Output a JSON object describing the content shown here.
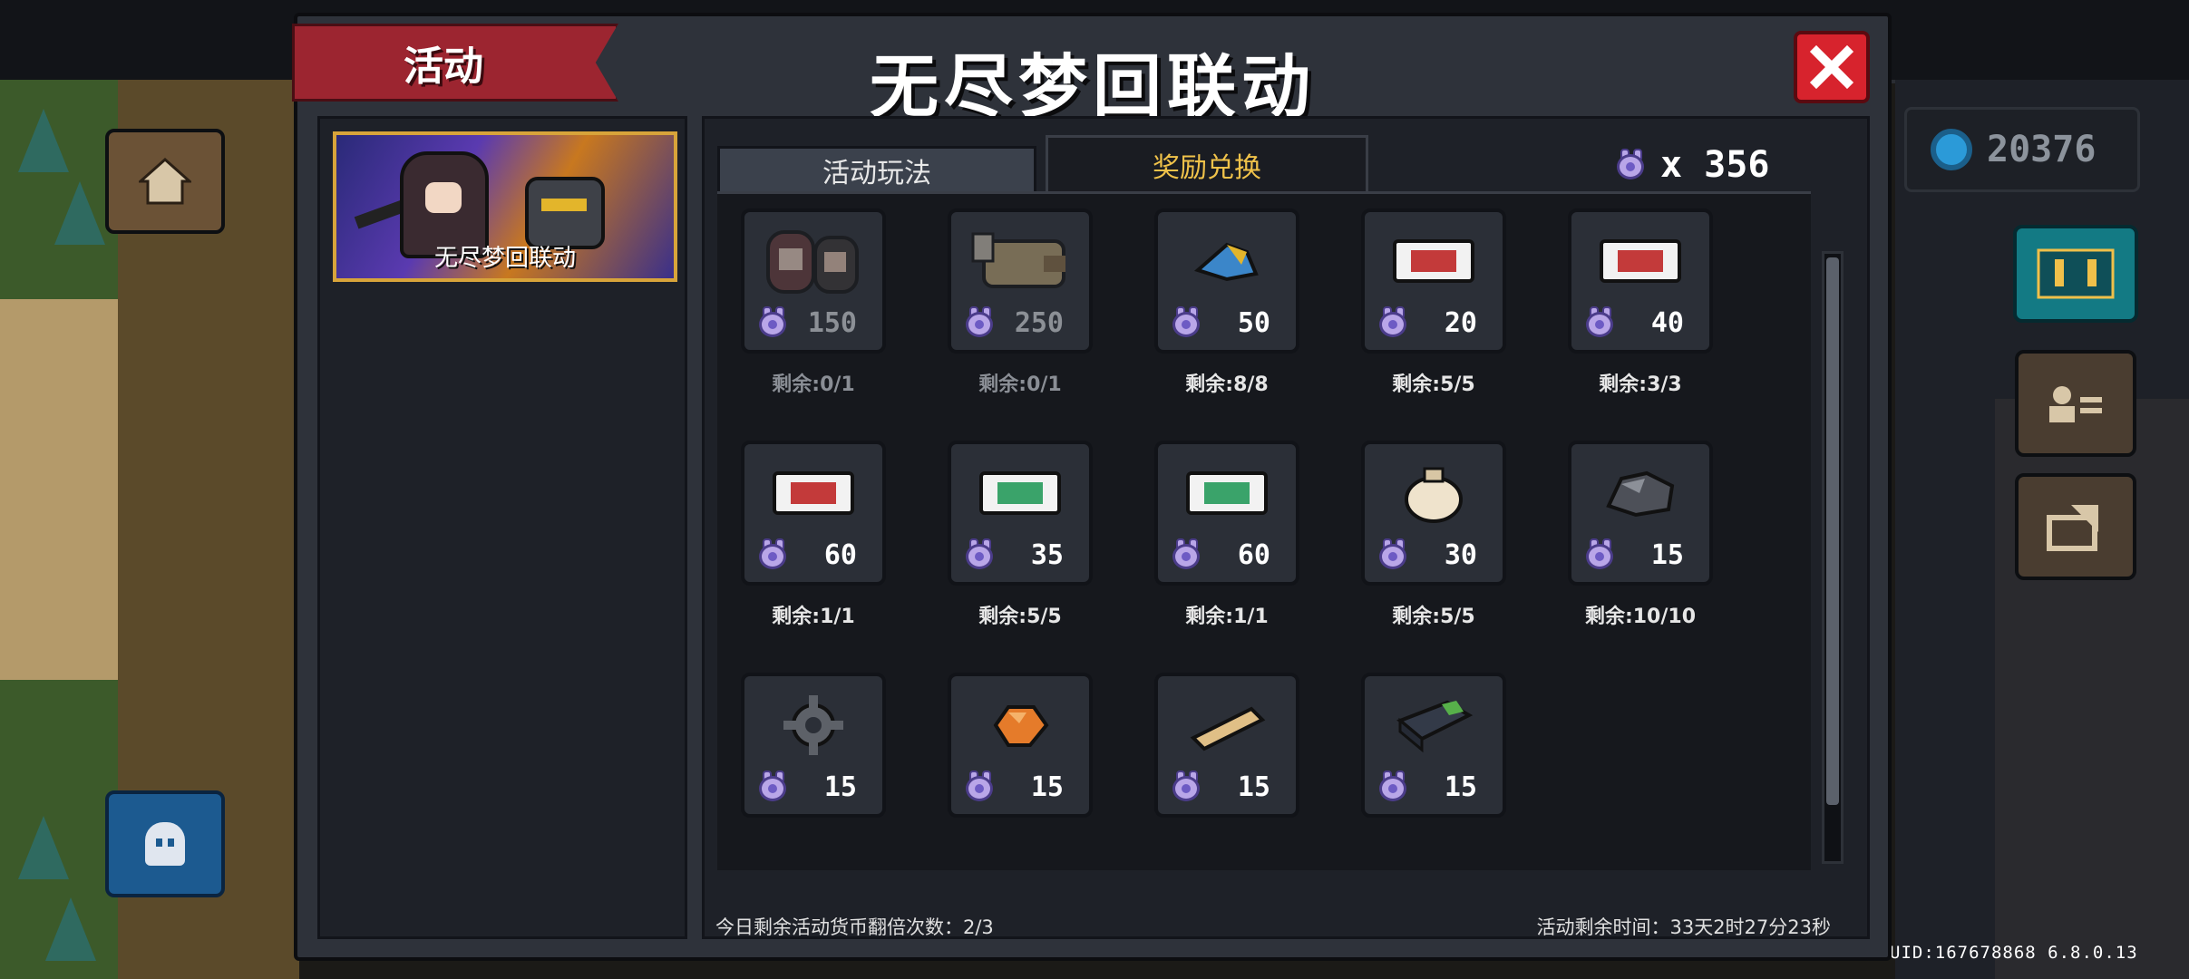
{
  "modal": {
    "category_label": "活动",
    "title": "无尽梦回联动"
  },
  "sidebar": {
    "events": [
      {
        "label": "无尽梦回联动",
        "selected": true
      }
    ]
  },
  "tabs": [
    {
      "label": "活动玩法",
      "active": false
    },
    {
      "label": "奖励兑换",
      "active": true
    }
  ],
  "currency": {
    "icon": "snail-token-icon",
    "label": "x 356"
  },
  "shop": {
    "items": [
      {
        "icon": "character-duo-icon",
        "price": "150",
        "stock": "剩余:0/1",
        "sold_out": true
      },
      {
        "icon": "pig-pet-icon",
        "price": "250",
        "stock": "剩余:0/1",
        "sold_out": true
      },
      {
        "icon": "fish-icon",
        "price": "50",
        "stock": "剩余:8/8",
        "sold_out": false
      },
      {
        "icon": "red-ticket-icon",
        "price": "20",
        "stock": "剩余:5/5",
        "sold_out": false
      },
      {
        "icon": "red-ticket-icon",
        "price": "40",
        "stock": "剩余:3/3",
        "sold_out": false
      },
      {
        "icon": "red-ticket-icon",
        "price": "60",
        "stock": "剩余:1/1",
        "sold_out": false
      },
      {
        "icon": "green-ticket-icon",
        "price": "35",
        "stock": "剩余:5/5",
        "sold_out": false
      },
      {
        "icon": "green-ticket-icon",
        "price": "60",
        "stock": "剩余:1/1",
        "sold_out": false
      },
      {
        "icon": "sack-icon",
        "price": "30",
        "stock": "剩余:5/5",
        "sold_out": false
      },
      {
        "icon": "ore-icon",
        "price": "15",
        "stock": "剩余:10/10",
        "sold_out": false
      },
      {
        "icon": "gear-icon",
        "price": "15",
        "stock": "",
        "sold_out": false
      },
      {
        "icon": "orange-gem-icon",
        "price": "15",
        "stock": "",
        "sold_out": false
      },
      {
        "icon": "wood-plank-icon",
        "price": "15",
        "stock": "",
        "sold_out": false
      },
      {
        "icon": "battery-icon",
        "price": "15",
        "stock": "",
        "sold_out": false
      }
    ]
  },
  "footer": {
    "double_count": "今日剩余活动货币翻倍次数：2/3",
    "time_left": "活动剩余时间：33天2时27分23秒"
  },
  "hud": {
    "gems": "20376",
    "uid": "UID:167678868 6.8.0.13"
  },
  "colors": {
    "ribbon_red": "#9c2530",
    "active_tab_text": "#f0c24a",
    "close_red": "#d7232d",
    "card_border_gold": "#d8a43a"
  }
}
